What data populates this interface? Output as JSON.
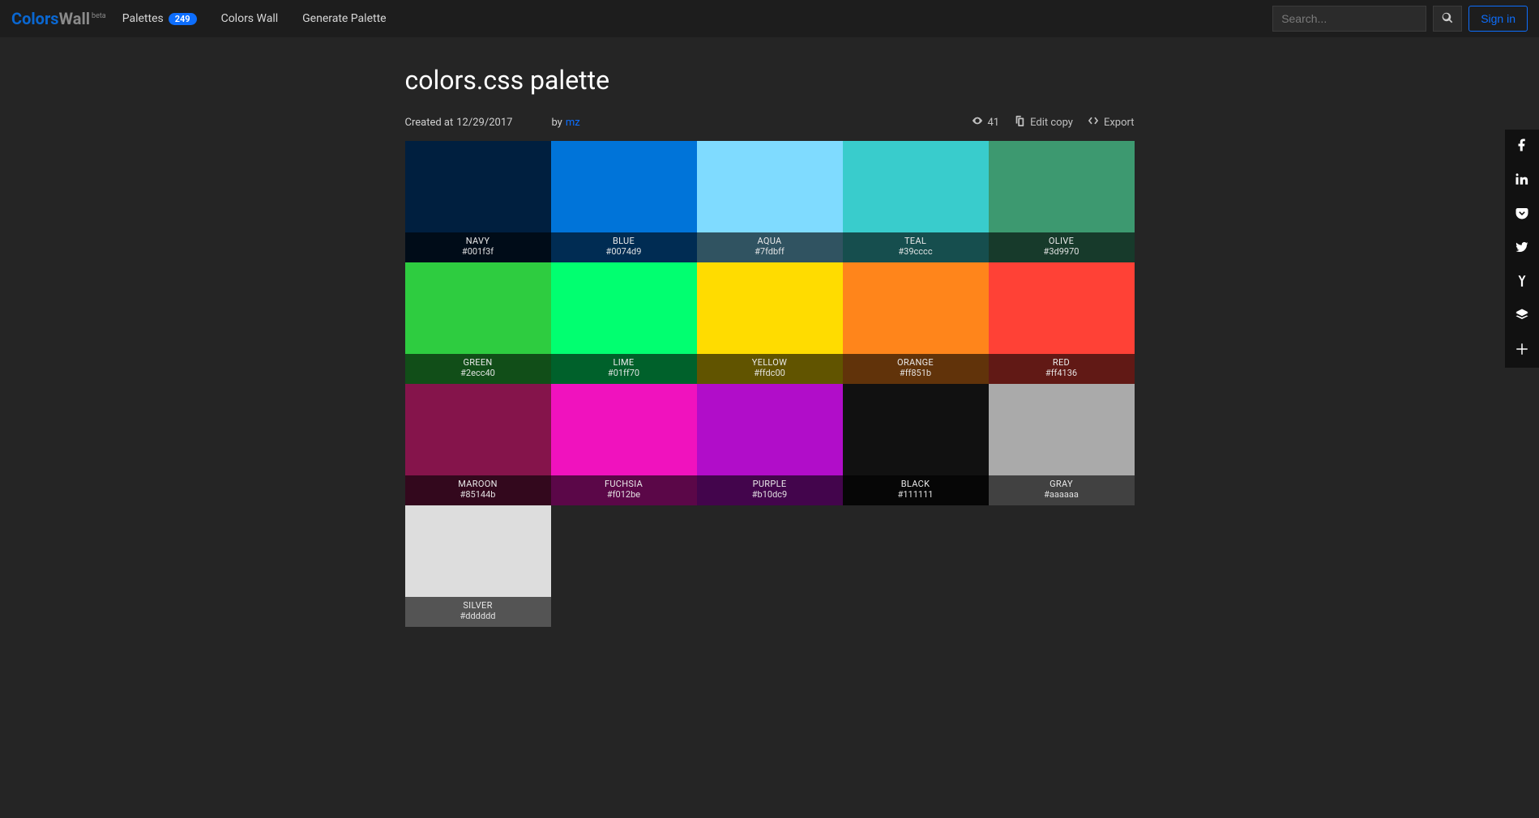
{
  "nav": {
    "logo_1": "Colors",
    "logo_2": "Wall",
    "logo_beta": "beta",
    "palettes_label": "Palettes",
    "palettes_count": "249",
    "colors_wall_label": "Colors Wall",
    "generate_label": "Generate Palette",
    "search_placeholder": "Search...",
    "signin_label": "Sign in"
  },
  "page": {
    "title": "colors.css palette",
    "created_at_label": "Created at",
    "created_at": "12/29/2017",
    "by_label": "by",
    "author": "mz",
    "views": "41",
    "edit_copy_label": "Edit copy",
    "export_label": "Export"
  },
  "share": {
    "facebook": "facebook",
    "linkedin": "linkedin",
    "pocket": "pocket",
    "twitter": "twitter",
    "hackernews": "hackernews",
    "buffer": "buffer",
    "more": "more"
  },
  "colors": [
    {
      "name": "NAVY",
      "hex": "#001f3f",
      "dark": true
    },
    {
      "name": "BLUE",
      "hex": "#0074d9",
      "dark": true
    },
    {
      "name": "AQUA",
      "hex": "#7fdbff",
      "dark": false
    },
    {
      "name": "TEAL",
      "hex": "#39cccc",
      "dark": false
    },
    {
      "name": "OLIVE",
      "hex": "#3d9970",
      "dark": true
    },
    {
      "name": "GREEN",
      "hex": "#2ecc40",
      "dark": true
    },
    {
      "name": "LIME",
      "hex": "#01ff70",
      "dark": false
    },
    {
      "name": "YELLOW",
      "hex": "#ffdc00",
      "dark": false
    },
    {
      "name": "ORANGE",
      "hex": "#ff851b",
      "dark": false
    },
    {
      "name": "RED",
      "hex": "#ff4136",
      "dark": true
    },
    {
      "name": "MAROON",
      "hex": "#85144b",
      "dark": true
    },
    {
      "name": "FUCHSIA",
      "hex": "#f012be",
      "dark": false
    },
    {
      "name": "PURPLE",
      "hex": "#b10dc9",
      "dark": true
    },
    {
      "name": "BLACK",
      "hex": "#111111",
      "dark": true
    },
    {
      "name": "GRAY",
      "hex": "#aaaaaa",
      "dark": false
    },
    {
      "name": "SILVER",
      "hex": "#dddddd",
      "dark": false
    }
  ]
}
